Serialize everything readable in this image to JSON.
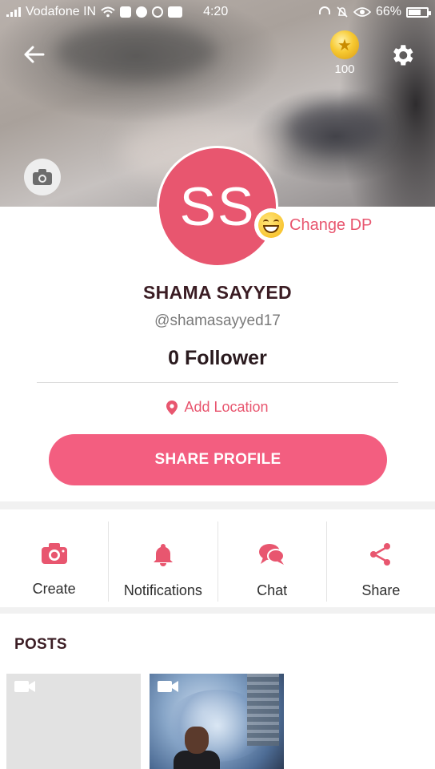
{
  "status_bar": {
    "carrier": "Vodafone IN",
    "time": "4:20",
    "battery": "66%",
    "battery_level": 0.66,
    "icons": [
      "signal-icon",
      "wifi-icon",
      "gallery-icon",
      "message-icon",
      "sync-icon",
      "video-icon",
      "headset-icon",
      "silent-icon",
      "eye-icon",
      "battery-icon"
    ]
  },
  "header": {
    "coins": "100",
    "icons": {
      "back": "arrow-left-icon",
      "coin": "coin-icon",
      "settings": "gear-icon",
      "cover_camera": "camera-icon"
    }
  },
  "profile": {
    "initials": "SS",
    "change_dp": "Change DP",
    "name": "SHAMA SAYYED",
    "handle": "@shamasayyed17",
    "followers": "0 Follower",
    "location": "Add Location",
    "share_button": "SHARE PROFILE",
    "colors": {
      "accent": "#e8566f",
      "button": "#f35e80"
    }
  },
  "actions": [
    {
      "label": "Create",
      "icon": "camera-icon"
    },
    {
      "label": "Notifications",
      "icon": "bell-icon"
    },
    {
      "label": "Chat",
      "icon": "chat-bubbles-icon"
    },
    {
      "label": "Share",
      "icon": "share-icon"
    }
  ],
  "posts": {
    "title": "POSTS",
    "items": [
      {
        "type": "video",
        "icon": "video-camera-icon"
      },
      {
        "type": "video",
        "icon": "video-camera-icon"
      }
    ]
  }
}
